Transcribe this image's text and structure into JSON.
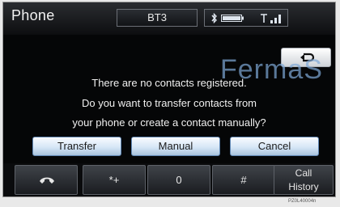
{
  "header": {
    "title": "Phone",
    "device_name": "BT3"
  },
  "status": {
    "bluetooth_icon": "bluetooth-icon",
    "battery_icon": "battery-icon",
    "signal_icon": "signal-icon"
  },
  "dialog": {
    "back_icon": "back-arrow-icon",
    "line1": "There are no contacts registered.",
    "line2": "Do you want to transfer contacts from",
    "line3": "your phone or create a contact manually?",
    "buttons": {
      "transfer": "Transfer",
      "manual": "Manual",
      "cancel": "Cancel"
    }
  },
  "watermark": "FermaS",
  "bottom_bar": {
    "hangup_icon": "phone-hangup-icon",
    "key_star": "*+",
    "key_zero": "0",
    "key_hash": "#",
    "call_history_line1": "Call",
    "call_history_line2": "History"
  },
  "image_code": "PZ0L40004n"
}
